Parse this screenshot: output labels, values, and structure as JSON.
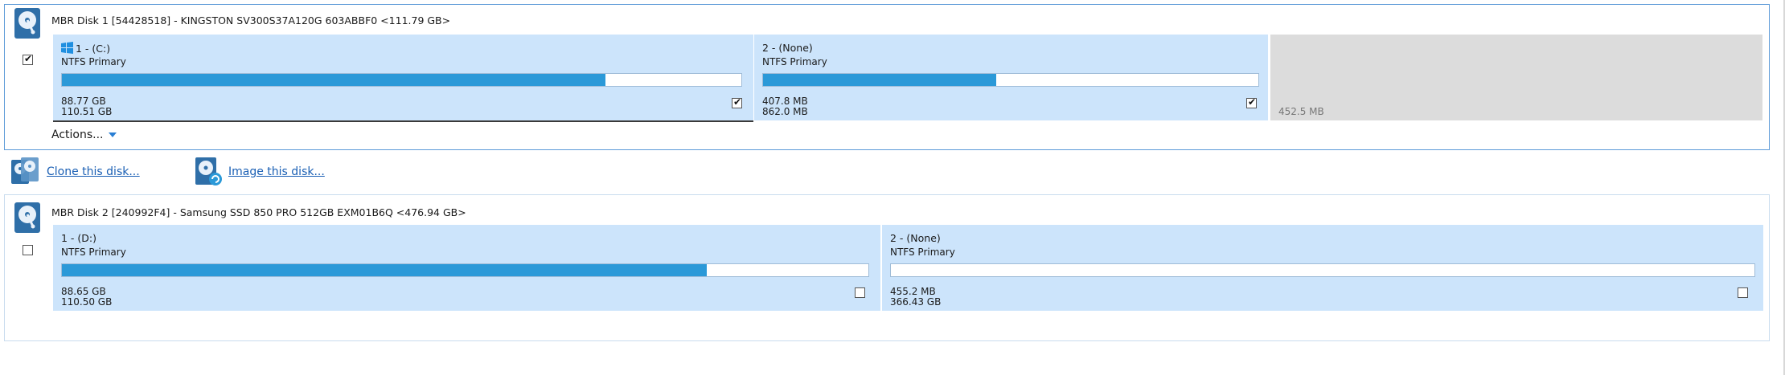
{
  "disks": [
    {
      "title": "MBR Disk 1 [54428518] - KINGSTON SV300S37A120G 603ABBF0  <111.79 GB>",
      "checked": true,
      "partitions": [
        {
          "name": "1 -  (C:)",
          "type": "NTFS Primary",
          "used": "88.77 GB",
          "total": "110.51 GB",
          "usage_fraction": 0.8,
          "checked": true,
          "icon": "windows-icon",
          "selected": true
        },
        {
          "name": "2 -  (None)",
          "type": "NTFS Primary",
          "used": "407.8 MB",
          "total": "862.0 MB",
          "usage_fraction": 0.47,
          "checked": true
        }
      ],
      "unallocated": {
        "size": "452.5 MB"
      },
      "actions_label": "Actions..."
    },
    {
      "title": "MBR Disk 2 [240992F4] - Samsung SSD 850 PRO 512GB EXM01B6Q  <476.94 GB>",
      "checked": false,
      "partitions": [
        {
          "name": "1 -  (D:)",
          "type": "NTFS Primary",
          "used": "88.65 GB",
          "total": "110.50 GB",
          "usage_fraction": 0.8,
          "checked": false
        },
        {
          "name": "2 -  (None)",
          "type": "NTFS Primary",
          "used": "455.2 MB",
          "total": "366.43 GB",
          "usage_fraction": 0.0,
          "checked": false
        }
      ]
    }
  ],
  "links": {
    "clone": "Clone this disk...",
    "image": "Image this disk..."
  },
  "colors": {
    "partition_bg": "#cce4fb",
    "usage_fill": "#2b99d8",
    "unallocated_bg": "#dcdcdc",
    "link": "#1a5fb4",
    "selected_border": "#5d9bd8"
  }
}
